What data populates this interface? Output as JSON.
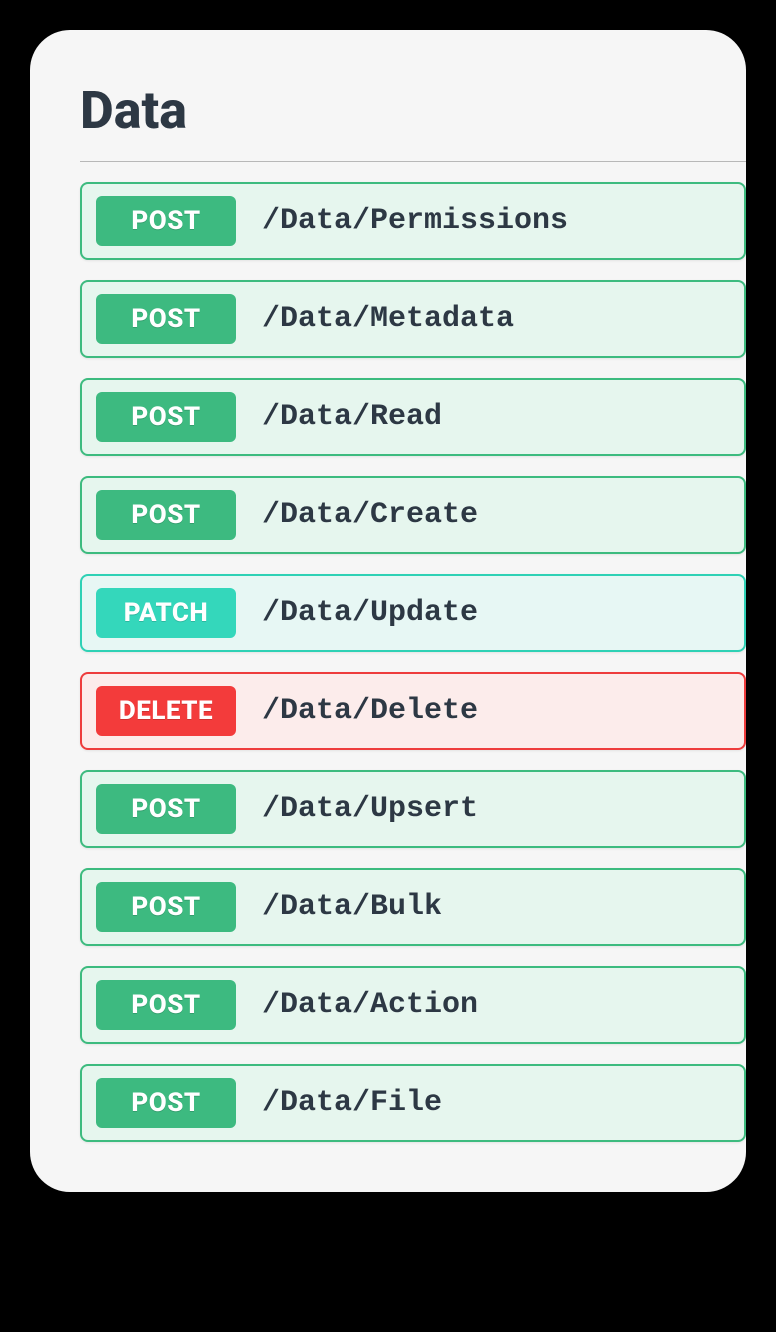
{
  "section": {
    "title": "Data"
  },
  "endpoints": [
    {
      "method": "POST",
      "path": "/Data/Permissions"
    },
    {
      "method": "POST",
      "path": "/Data/Metadata"
    },
    {
      "method": "POST",
      "path": "/Data/Read"
    },
    {
      "method": "POST",
      "path": "/Data/Create"
    },
    {
      "method": "PATCH",
      "path": "/Data/Update"
    },
    {
      "method": "DELETE",
      "path": "/Data/Delete"
    },
    {
      "method": "POST",
      "path": "/Data/Upsert"
    },
    {
      "method": "POST",
      "path": "/Data/Bulk"
    },
    {
      "method": "POST",
      "path": "/Data/Action"
    },
    {
      "method": "POST",
      "path": "/Data/File"
    }
  ]
}
